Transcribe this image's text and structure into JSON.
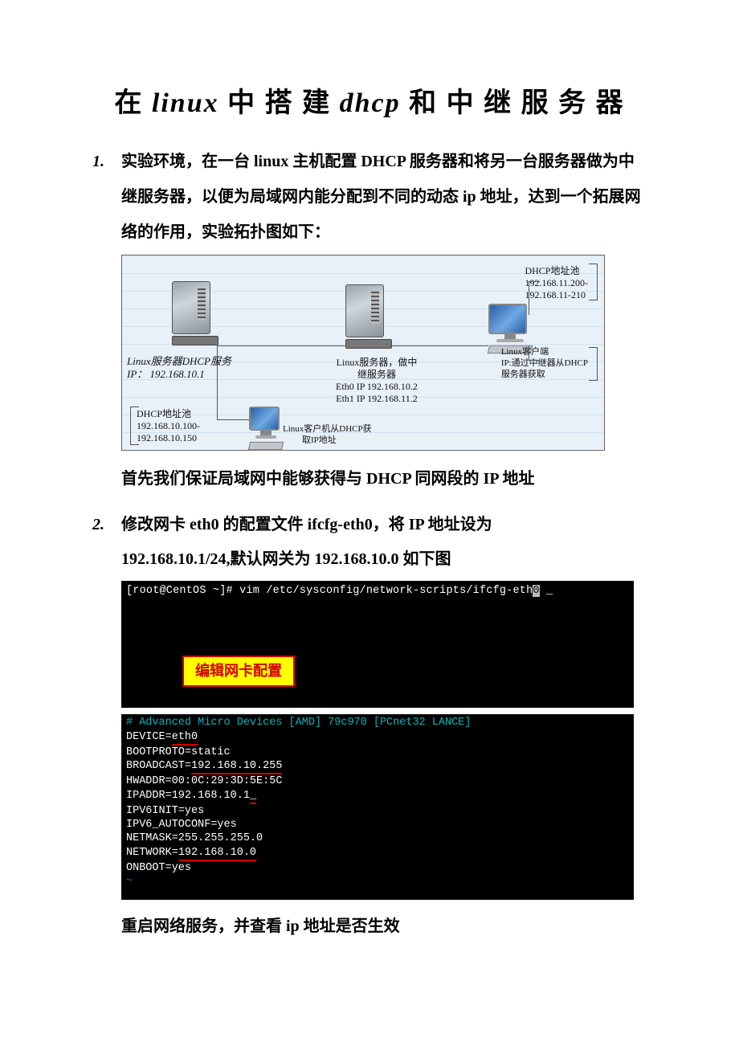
{
  "title_parts": {
    "p1": "在",
    "p2": "linux",
    "p3": " 中 搭 建 ",
    "p4": "dhcp",
    "p5": " 和 中 继 服 务 器"
  },
  "item1": {
    "num": "1.",
    "text": "实验环境，在一台 linux 主机配置 DHCP 服务器和将另一台服务器做为中继服务器，以便为局域网内能分配到不同的动态 ip 地址，达到一个拓展网络的作用，实验拓扑图如下："
  },
  "diagram": {
    "dhcp_server_label_a": "Linux服务器DHCP服务",
    "dhcp_server_label_b": "IP： 192.168.10.1",
    "relay_label_a": "Linux服务器，做中",
    "relay_label_b": "继服务器",
    "relay_label_c": "Eth0 IP 192.168.10.2",
    "relay_label_d": "Eth1 IP 192.168.11.2",
    "pool10_a": "DHCP地址池",
    "pool10_b": "192.168.10.100-",
    "pool10_c": "192.168.10.150",
    "client10": "Linux客户机从DHCP获",
    "client10b": "取IP地址",
    "pool11_a": "DHCP地址池",
    "pool11_b": "192.168.11.200-",
    "pool11_c": "192.168.11-210",
    "client11_a": "Linux客户端",
    "client11_b": "IP:通过中继器从DHCP",
    "client11_c": "服务器获取"
  },
  "para_after_diagram": "首先我们保证局域网中能够获得与 DHCP 同网段的 IP 地址",
  "item2": {
    "num": "2.",
    "text_a": "修改网卡 eth0 的配置文件 ifcfg-eth0，将 IP 地址设为",
    "text_b": "192.168.10.1/24,默认网关为 192.168.10.0 如下图"
  },
  "terminal1": {
    "prompt": "[root@CentOS ~]# vim /etc/sysconfig/network-scripts/ifcfg-eth0 _",
    "annotation": "编辑网卡配置"
  },
  "terminal2": {
    "comment": "# Advanced Micro Devices [AMD] 79c970 [PCnet32 LANCE]",
    "l1a": "DEVICE=",
    "l1b": "eth0",
    "l2": "BOOTPROTO=static",
    "l3a": "BROADCAST=",
    "l3b": "192.168.10.255",
    "l4": "HWADDR=00:0C:29:3D:5E:5C",
    "l5a": "IPADDR=192.168.10.1",
    "l5b": "_",
    "l6": "IPV6INIT=yes",
    "l7": "IPV6_AUTOCONF=yes",
    "l8": "NETMASK=255.255.255.0",
    "l9a": "NETWORK=",
    "l9b": "192.168.10.0",
    "l10": "ONBOOT=yes",
    "tilde": "~"
  },
  "para_last": "重启网络服务，并查看 ip 地址是否生效"
}
